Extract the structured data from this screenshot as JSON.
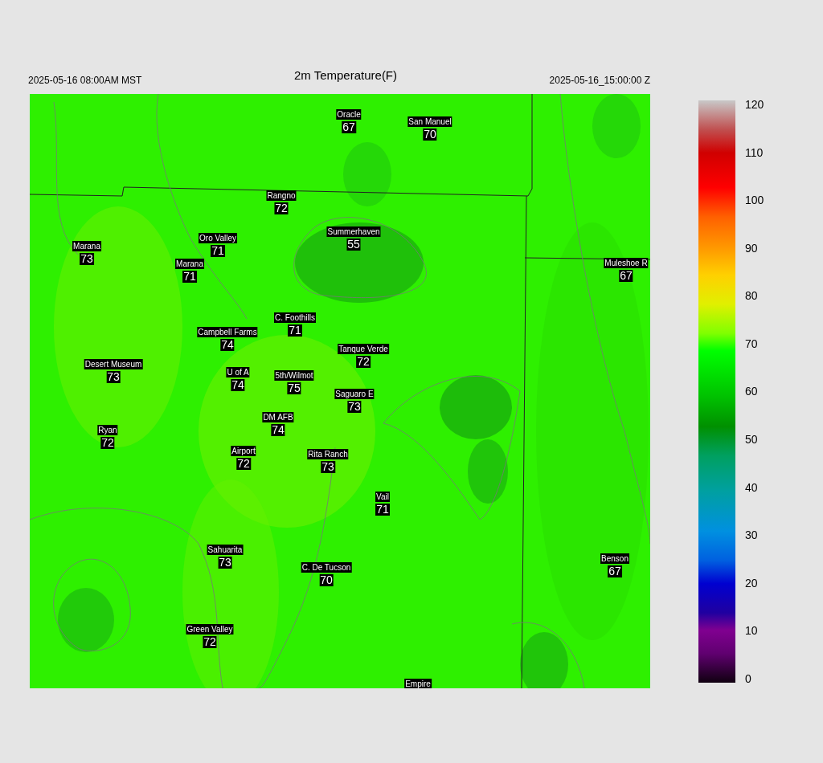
{
  "header": {
    "local_time": "2025-05-16 08:00AM MST",
    "title": "2m Temperature(F)",
    "valid_time": "2025-05-16_15:00:00 Z"
  },
  "stations": [
    {
      "name": "Oracle",
      "value": "67"
    },
    {
      "name": "San Manuel",
      "value": "70"
    },
    {
      "name": "Rangno",
      "value": "72"
    },
    {
      "name": "Summerhaven",
      "value": "55"
    },
    {
      "name": "Marana",
      "value": "73"
    },
    {
      "name": "Oro Valley",
      "value": "71"
    },
    {
      "name": "Marana",
      "value": "71"
    },
    {
      "name": "Muleshoe R",
      "value": "67"
    },
    {
      "name": "C. Foothills",
      "value": "71"
    },
    {
      "name": "Campbell Farms",
      "value": "74"
    },
    {
      "name": "Tanque Verde",
      "value": "72"
    },
    {
      "name": "Desert Museum",
      "value": "73"
    },
    {
      "name": "U of A",
      "value": "74"
    },
    {
      "name": "5th/Wilmot",
      "value": "75"
    },
    {
      "name": "Saguaro E",
      "value": "73"
    },
    {
      "name": "DM AFB",
      "value": "74"
    },
    {
      "name": "Ryan",
      "value": "72"
    },
    {
      "name": "Airport",
      "value": "72"
    },
    {
      "name": "Rita Ranch",
      "value": "73"
    },
    {
      "name": "Vail",
      "value": "71"
    },
    {
      "name": "Sahuarita",
      "value": "73"
    },
    {
      "name": "Benson",
      "value": "67"
    },
    {
      "name": "C. De Tucson",
      "value": "70"
    },
    {
      "name": "Green Valley",
      "value": "72"
    },
    {
      "name": "Empire"
    }
  ],
  "colorbar": {
    "ticks": [
      "120",
      "110",
      "100",
      "90",
      "80",
      "70",
      "60",
      "50",
      "40",
      "30",
      "20",
      "10",
      "0"
    ]
  }
}
